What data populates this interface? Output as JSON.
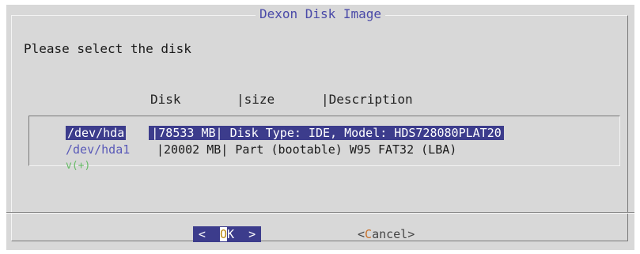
{
  "dialog": {
    "title": "Dexon Disk Image",
    "prompt": "Please select the disk"
  },
  "columns": {
    "disk": "Disk",
    "size": "|size",
    "description": "|Description"
  },
  "disks": [
    {
      "device": "/dev/hda",
      "info": "|78533 MB| Disk Type: IDE, Model: HDS728080PLAT20",
      "selected": true
    },
    {
      "device": "/dev/hda1",
      "info": "|20002 MB| Part (bootable) W95 FAT32 (LBA)",
      "selected": false
    }
  ],
  "more_indicator": "v(+)",
  "buttons": {
    "ok": {
      "left": "<  ",
      "hot": "O",
      "rest": "K  >"
    },
    "cancel": {
      "left": "<",
      "hot": "C",
      "rest": "ancel>"
    }
  }
}
